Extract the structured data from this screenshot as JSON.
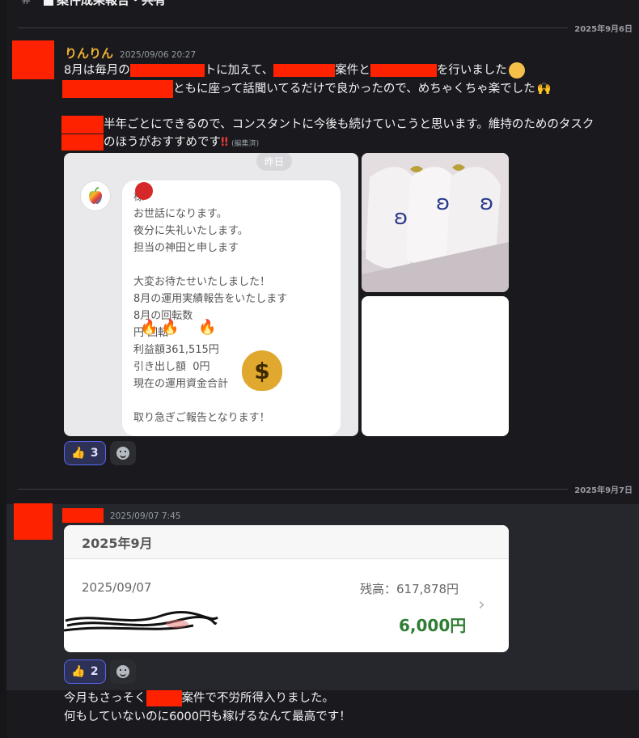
{
  "header": {
    "channel_prefix": "#",
    "channel_name": "案件成果報告・共有"
  },
  "dividers": [
    "2025年9月6日",
    "2025年9月7日"
  ],
  "message1": {
    "username": "りんりん",
    "timestamp": "2025/09/06 20:27",
    "line1_a": "8月は毎月の",
    "line1_b": "トに加えて、",
    "line1_c": "案件と",
    "line1_d": "を行いました",
    "line2": "ともに座って話聞いてるだけで良かったので、めちゃくちゃ楽でした",
    "line3": "半年ごとにできるので、コンスタントに今後も続けていこうと思います。維持のためのタスク",
    "line4": "のほうがおすすめです",
    "edited": "(編集済)",
    "chat_day": "昨日",
    "chat_text": "様\nお世話になります。\n夜分に失礼いたします。\n担当の神田と申します\n\n大変お待たせいたしました！\n8月の運用実績報告をいたします\n8月の回転数\n円 回転\n利益額361,515円\n引き出し額  0円\n現在の運用資金合計          円\n\n取り急ぎご報告となります！",
    "reaction_count": "3"
  },
  "message2": {
    "timestamp": "2025/09/07 7:45",
    "bank_header": "2025年9月",
    "bank_date": "2025/09/07",
    "bank_balance": "残高：617,878円",
    "bank_amount": "6,000円",
    "reaction_count": "2",
    "line1_a": "今月もさっそく",
    "line1_b": "案件で不労所得入りました。",
    "line2": "何もしていないのに6000円も稼げるなんて最高です！"
  },
  "colors": {
    "accent": "#5865f2",
    "username": "#f0b232",
    "redaction": "#ff2200",
    "amount_green": "#2e7d32"
  },
  "icons": [
    "thumbs-up-icon",
    "add-reaction-icon",
    "money-bag-icon",
    "fire-icon",
    "apple-icon",
    "chevron-right-icon"
  ]
}
